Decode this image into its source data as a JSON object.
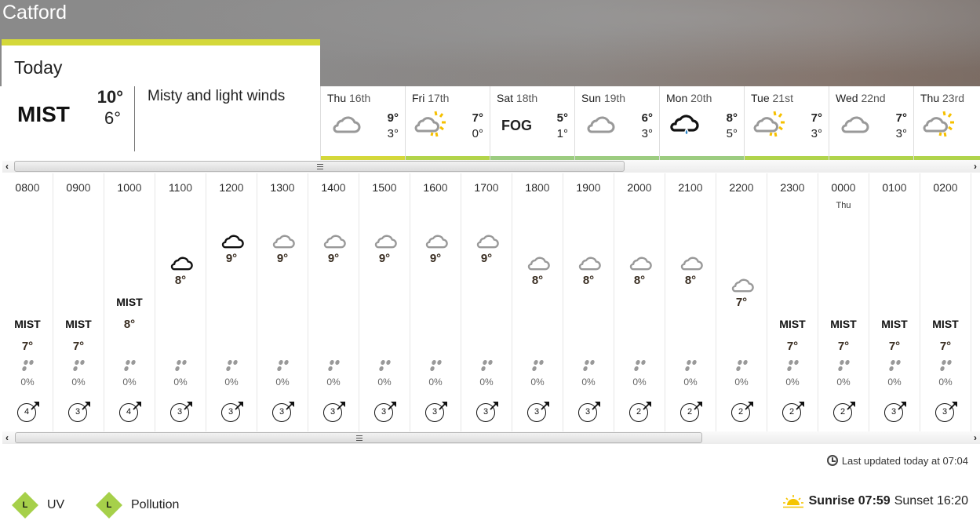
{
  "location": "Catford",
  "today": {
    "label": "Today",
    "condition": "MIST",
    "high": "10°",
    "low": "6°",
    "description": "Misty and light winds",
    "bar_color": "#d4d83a"
  },
  "days": [
    {
      "name": "Thu",
      "num": "16th",
      "icon": "cloud-grey",
      "high": "9°",
      "low": "3°",
      "bar_color": "#d4d83a"
    },
    {
      "name": "Fri",
      "num": "17th",
      "icon": "sun-cloud",
      "high": "7°",
      "low": "0°",
      "bar_color": "#b2d44a"
    },
    {
      "name": "Sat",
      "num": "18th",
      "icon": "fog",
      "label": "FOG",
      "high": "5°",
      "low": "1°",
      "bar_color": "#9ccc80"
    },
    {
      "name": "Sun",
      "num": "19th",
      "icon": "cloud-grey",
      "high": "6°",
      "low": "3°",
      "bar_color": "#9ccc80"
    },
    {
      "name": "Mon",
      "num": "20th",
      "icon": "rain-cloud",
      "high": "8°",
      "low": "5°",
      "bar_color": "#9ccc80"
    },
    {
      "name": "Tue",
      "num": "21st",
      "icon": "sun-cloud",
      "high": "7°",
      "low": "3°",
      "bar_color": "#b0d44c"
    },
    {
      "name": "Wed",
      "num": "22nd",
      "icon": "cloud-grey",
      "high": "7°",
      "low": "3°",
      "bar_color": "#b0d44c"
    },
    {
      "name": "Thu",
      "num": "23rd",
      "icon": "sun-cloud",
      "high": "",
      "low": "",
      "bar_color": "#b0d44c"
    }
  ],
  "hours": [
    {
      "hh": "08",
      "mm": "00",
      "day": "",
      "cond": "mist",
      "label": "MIST",
      "temp": "7°",
      "t": 7,
      "rain": "0%",
      "wind": "4"
    },
    {
      "hh": "09",
      "mm": "00",
      "day": "",
      "cond": "mist",
      "label": "MIST",
      "temp": "7°",
      "t": 7,
      "rain": "0%",
      "wind": "3"
    },
    {
      "hh": "10",
      "mm": "00",
      "day": "",
      "cond": "mist",
      "label": "MIST",
      "temp": "8°",
      "t": 8,
      "rain": "0%",
      "wind": "4"
    },
    {
      "hh": "11",
      "mm": "00",
      "day": "",
      "cond": "cloud-black",
      "label": "",
      "temp": "8°",
      "t": 8,
      "rain": "0%",
      "wind": "3"
    },
    {
      "hh": "12",
      "mm": "00",
      "day": "",
      "cond": "cloud-black",
      "label": "",
      "temp": "9°",
      "t": 9,
      "rain": "0%",
      "wind": "3"
    },
    {
      "hh": "13",
      "mm": "00",
      "day": "",
      "cond": "cloud-grey",
      "label": "",
      "temp": "9°",
      "t": 9,
      "rain": "0%",
      "wind": "3"
    },
    {
      "hh": "14",
      "mm": "00",
      "day": "",
      "cond": "cloud-grey",
      "label": "",
      "temp": "9°",
      "t": 9,
      "rain": "0%",
      "wind": "3"
    },
    {
      "hh": "15",
      "mm": "00",
      "day": "",
      "cond": "cloud-grey",
      "label": "",
      "temp": "9°",
      "t": 9,
      "rain": "0%",
      "wind": "3"
    },
    {
      "hh": "16",
      "mm": "00",
      "day": "",
      "cond": "cloud-grey",
      "label": "",
      "temp": "9°",
      "t": 9,
      "rain": "0%",
      "wind": "3"
    },
    {
      "hh": "17",
      "mm": "00",
      "day": "",
      "cond": "cloud-grey",
      "label": "",
      "temp": "9°",
      "t": 9,
      "rain": "0%",
      "wind": "3"
    },
    {
      "hh": "18",
      "mm": "00",
      "day": "",
      "cond": "cloud-grey",
      "label": "",
      "temp": "8°",
      "t": 8,
      "rain": "0%",
      "wind": "3"
    },
    {
      "hh": "19",
      "mm": "00",
      "day": "",
      "cond": "cloud-grey",
      "label": "",
      "temp": "8°",
      "t": 8,
      "rain": "0%",
      "wind": "3"
    },
    {
      "hh": "20",
      "mm": "00",
      "day": "",
      "cond": "cloud-grey",
      "label": "",
      "temp": "8°",
      "t": 8,
      "rain": "0%",
      "wind": "2"
    },
    {
      "hh": "21",
      "mm": "00",
      "day": "",
      "cond": "cloud-grey",
      "label": "",
      "temp": "8°",
      "t": 8,
      "rain": "0%",
      "wind": "2"
    },
    {
      "hh": "22",
      "mm": "00",
      "day": "",
      "cond": "cloud-grey",
      "label": "",
      "temp": "7°",
      "t": 7,
      "rain": "0%",
      "wind": "2"
    },
    {
      "hh": "23",
      "mm": "00",
      "day": "",
      "cond": "mist",
      "label": "MIST",
      "temp": "7°",
      "t": 7,
      "rain": "0%",
      "wind": "2"
    },
    {
      "hh": "00",
      "mm": "00",
      "day": "Thu",
      "cond": "mist",
      "label": "MIST",
      "temp": "7°",
      "t": 7,
      "rain": "0%",
      "wind": "2"
    },
    {
      "hh": "01",
      "mm": "00",
      "day": "",
      "cond": "mist",
      "label": "MIST",
      "temp": "7°",
      "t": 7,
      "rain": "0%",
      "wind": "3"
    },
    {
      "hh": "02",
      "mm": "00",
      "day": "",
      "cond": "mist",
      "label": "MIST",
      "temp": "7°",
      "t": 7,
      "rain": "0%",
      "wind": "3"
    }
  ],
  "last_updated": "Last updated today at 07:04",
  "indices": [
    {
      "level": "L",
      "label": "UV",
      "color": "#a6d04a"
    },
    {
      "level": "L",
      "label": "Pollution",
      "color": "#a6d04a"
    }
  ],
  "sun": {
    "sunrise_label": "Sunrise",
    "sunrise": "07:59",
    "sunset_label": "Sunset",
    "sunset": "16:20"
  }
}
